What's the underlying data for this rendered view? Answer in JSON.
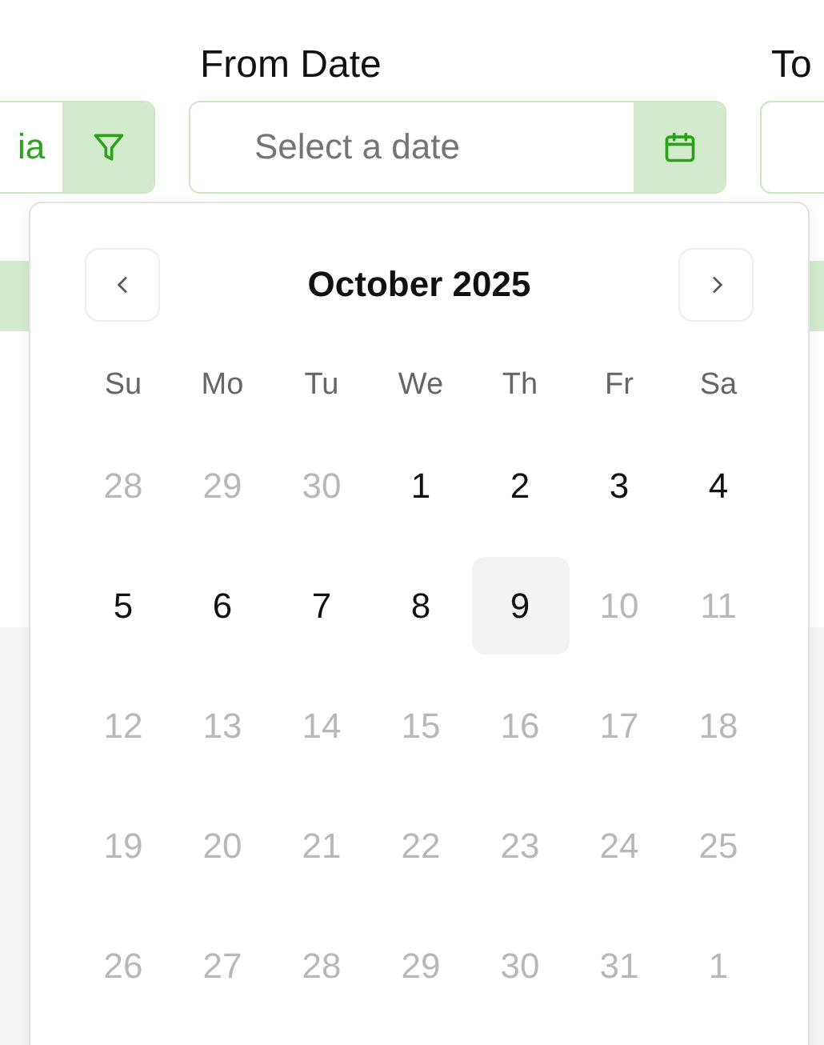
{
  "filters": {
    "category_field": {
      "value": "ia"
    },
    "from_date": {
      "label": "From Date",
      "placeholder": "Select a date"
    },
    "to_date": {
      "label": "To"
    }
  },
  "calendar": {
    "title": "October 2025",
    "weekdays": [
      "Su",
      "Mo",
      "Tu",
      "We",
      "Th",
      "Fr",
      "Sa"
    ],
    "weeks": [
      [
        {
          "day": "28",
          "muted": true,
          "today": false
        },
        {
          "day": "29",
          "muted": true,
          "today": false
        },
        {
          "day": "30",
          "muted": true,
          "today": false
        },
        {
          "day": "1",
          "muted": false,
          "today": false
        },
        {
          "day": "2",
          "muted": false,
          "today": false
        },
        {
          "day": "3",
          "muted": false,
          "today": false
        },
        {
          "day": "4",
          "muted": false,
          "today": false
        }
      ],
      [
        {
          "day": "5",
          "muted": false,
          "today": false
        },
        {
          "day": "6",
          "muted": false,
          "today": false
        },
        {
          "day": "7",
          "muted": false,
          "today": false
        },
        {
          "day": "8",
          "muted": false,
          "today": false
        },
        {
          "day": "9",
          "muted": false,
          "today": true
        },
        {
          "day": "10",
          "muted": true,
          "today": false
        },
        {
          "day": "11",
          "muted": true,
          "today": false
        }
      ],
      [
        {
          "day": "12",
          "muted": true,
          "today": false
        },
        {
          "day": "13",
          "muted": true,
          "today": false
        },
        {
          "day": "14",
          "muted": true,
          "today": false
        },
        {
          "day": "15",
          "muted": true,
          "today": false
        },
        {
          "day": "16",
          "muted": true,
          "today": false
        },
        {
          "day": "17",
          "muted": true,
          "today": false
        },
        {
          "day": "18",
          "muted": true,
          "today": false
        }
      ],
      [
        {
          "day": "19",
          "muted": true,
          "today": false
        },
        {
          "day": "20",
          "muted": true,
          "today": false
        },
        {
          "day": "21",
          "muted": true,
          "today": false
        },
        {
          "day": "22",
          "muted": true,
          "today": false
        },
        {
          "day": "23",
          "muted": true,
          "today": false
        },
        {
          "day": "24",
          "muted": true,
          "today": false
        },
        {
          "day": "25",
          "muted": true,
          "today": false
        }
      ],
      [
        {
          "day": "26",
          "muted": true,
          "today": false
        },
        {
          "day": "27",
          "muted": true,
          "today": false
        },
        {
          "day": "28",
          "muted": true,
          "today": false
        },
        {
          "day": "29",
          "muted": true,
          "today": false
        },
        {
          "day": "30",
          "muted": true,
          "today": false
        },
        {
          "day": "31",
          "muted": true,
          "today": false
        },
        {
          "day": "1",
          "muted": true,
          "today": false
        }
      ]
    ]
  }
}
